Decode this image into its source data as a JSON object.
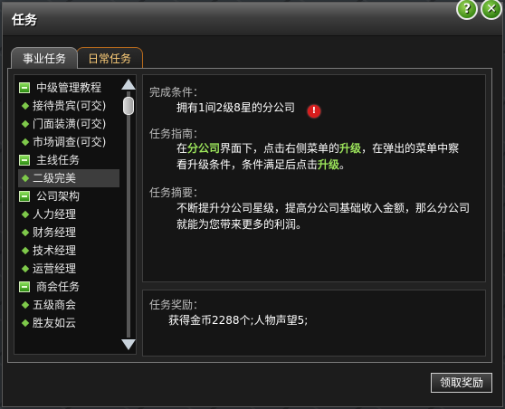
{
  "window": {
    "title": "任务"
  },
  "buttons": {
    "help": "?",
    "close": "✕",
    "claim": "领取奖励"
  },
  "tabs": [
    {
      "label": "事业任务",
      "active": true
    },
    {
      "label": "日常任务",
      "active": false
    }
  ],
  "task_list": {
    "categories": [
      {
        "label": "中级管理教程",
        "items": [
          "接待贵宾(可交)",
          "门面装潢(可交)",
          "市场调查(可交)"
        ]
      },
      {
        "label": "主线任务",
        "items": [
          "二级完美"
        ]
      },
      {
        "label": "公司架构",
        "items": [
          "人力经理",
          "财务经理",
          "技术经理",
          "运营经理"
        ]
      },
      {
        "label": "商会任务",
        "items": [
          "五级商会",
          "胜友如云"
        ]
      }
    ],
    "selected": "二级完美"
  },
  "detail": {
    "condition_label": "完成条件：",
    "condition_text": "拥有1间2级8星的分公司",
    "guide_label": "任务指南：",
    "guide_parts": {
      "p1": "在",
      "h1": "分公司",
      "p2": "界面下，点击右侧菜单的",
      "h2": "升级",
      "p3": "，在弹出的菜单中察",
      "p4": "看升级条件，条件满足后点击",
      "h3": "升级",
      "p5": "。"
    },
    "summary_label": "任务摘要：",
    "summary_line1": "不断提升分公司星级，提高分公司基础收入金额，那么分公司",
    "summary_line2": "就能为您带来更多的利润。"
  },
  "reward": {
    "label": "任务奖励：",
    "text": "获得金币2288个;人物声望5;"
  },
  "colors": {
    "highlight": "#9be35a",
    "tab_inactive_border": "#b4681c",
    "warning": "#d81d1d"
  }
}
